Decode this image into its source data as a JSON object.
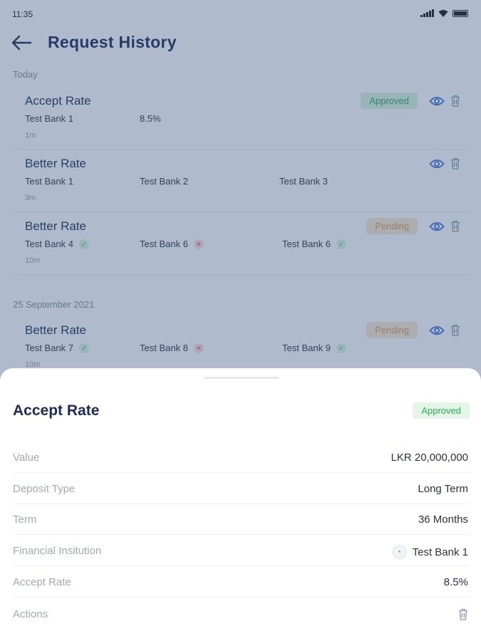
{
  "status_bar": {
    "time": "11:35"
  },
  "header": {
    "title": "Request History"
  },
  "sections": [
    {
      "label": "Today"
    },
    {
      "label": "25 September 2021"
    }
  ],
  "requests": [
    {
      "title": "Accept Rate",
      "status": "Approved",
      "banks": [
        {
          "name": "Test Bank 1",
          "state": ""
        }
      ],
      "rate": "8.5%",
      "time": "1m"
    },
    {
      "title": "Better Rate",
      "status": "",
      "banks": [
        {
          "name": "Test Bank 1",
          "state": ""
        },
        {
          "name": "Test Bank 2",
          "state": ""
        },
        {
          "name": "Test Bank 3",
          "state": ""
        }
      ],
      "time": "3m"
    },
    {
      "title": "Better Rate",
      "status": "Pending",
      "banks": [
        {
          "name": "Test Bank 4",
          "state": "accepted"
        },
        {
          "name": "Test Bank 6",
          "state": "rejected"
        },
        {
          "name": "Test Bank 6",
          "state": "accepted"
        }
      ],
      "time": "10m"
    },
    {
      "title": "Better Rate",
      "status": "Pending",
      "banks": [
        {
          "name": "Test Bank 7",
          "state": "accepted"
        },
        {
          "name": "Test Bank 8",
          "state": "rejected"
        },
        {
          "name": "Test Bank 9",
          "state": "accepted"
        }
      ],
      "time": "10m"
    }
  ],
  "detail_sheet": {
    "title": "Accept Rate",
    "status": "Approved",
    "rows": [
      {
        "label": "Value",
        "value": "LKR 20,000,000"
      },
      {
        "label": "Deposit Type",
        "value": "Long Term"
      },
      {
        "label": "Term",
        "value": "36 Months"
      },
      {
        "label": "Financial Insitution",
        "value": "Test Bank 1",
        "logo": "bank-logo"
      },
      {
        "label": "Accept Rate",
        "value": "8.5%"
      },
      {
        "label": "Actions",
        "icon": "trash-icon"
      }
    ]
  },
  "colors": {
    "primary": "#1f2a55",
    "approved_text": "#2eaa55",
    "approved_bg": "#d8f3e0",
    "pending_text": "#e49a52",
    "pending_bg": "#fbe8d3",
    "icon_blue": "#3b6fd0",
    "overlay": "#385480"
  }
}
